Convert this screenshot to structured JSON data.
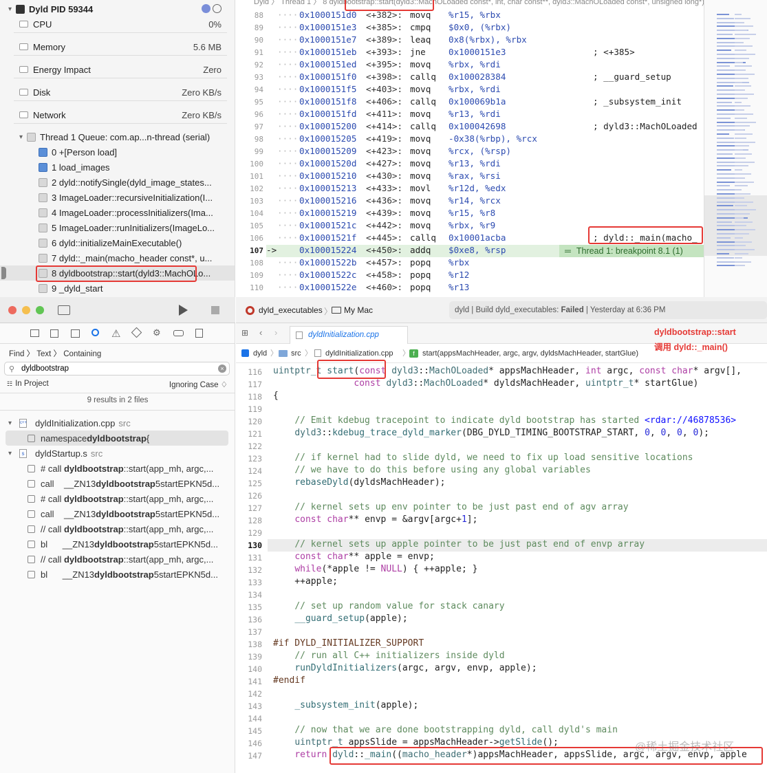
{
  "debug_nav": {
    "process": "Dyld PID 59344",
    "gauges": [
      {
        "label": "CPU",
        "value": "0%"
      },
      {
        "label": "Memory",
        "value": "5.6 MB"
      },
      {
        "label": "Energy Impact",
        "value": "Zero"
      },
      {
        "label": "Disk",
        "value": "Zero KB/s"
      },
      {
        "label": "Network",
        "value": "Zero KB/s"
      }
    ],
    "thread": "Thread 1 Queue: com.ap...n-thread (serial)",
    "frames": [
      "0 +[Person load]",
      "1 load_images",
      "2 dyld::notifySingle(dyld_image_states...",
      "3 ImageLoader::recursiveInitialization(I...",
      "4 ImageLoader::processInitializers(Ima...",
      "5 ImageLoader::runInitializers(ImageLo...",
      "6 dyld::initializeMainExecutable()",
      "7 dyld::_main(macho_header const*, u...",
      "8 dyldbootstrap::start(dyld3::MachOLo...",
      "9 _dyld_start"
    ]
  },
  "disasm": {
    "jumpbar": {
      "p1": "Dyld",
      "p2": "Thread 1",
      "p3": "8 dyldbootstrap::start(dyld3::MachOLoaded const*, int, char const**, dyld3::MachOLoaded const*, unsigned long*)"
    },
    "lines": [
      {
        "n": "88",
        "a": "0x1000151d0",
        "o": "<+382>:",
        "i": "movq",
        "ops": "%r15, %rbx",
        "c": ""
      },
      {
        "n": "89",
        "a": "0x1000151e3",
        "o": "<+385>:",
        "i": "cmpq",
        "ops": "$0x0, (%rbx)",
        "c": ""
      },
      {
        "n": "90",
        "a": "0x1000151e7",
        "o": "<+389>:",
        "i": "leaq",
        "ops": "0x8(%rbx), %rbx",
        "c": ""
      },
      {
        "n": "91",
        "a": "0x1000151eb",
        "o": "<+393>:",
        "i": "jne",
        "ops": "0x1000151e3",
        "c": "; <+385>"
      },
      {
        "n": "92",
        "a": "0x1000151ed",
        "o": "<+395>:",
        "i": "movq",
        "ops": "%rbx, %rdi",
        "c": ""
      },
      {
        "n": "93",
        "a": "0x1000151f0",
        "o": "<+398>:",
        "i": "callq",
        "ops": "0x100028384",
        "c": "; __guard_setup"
      },
      {
        "n": "94",
        "a": "0x1000151f5",
        "o": "<+403>:",
        "i": "movq",
        "ops": "%rbx, %rdi",
        "c": ""
      },
      {
        "n": "95",
        "a": "0x1000151f8",
        "o": "<+406>:",
        "i": "callq",
        "ops": "0x100069b1a",
        "c": "; _subsystem_init"
      },
      {
        "n": "96",
        "a": "0x1000151fd",
        "o": "<+411>:",
        "i": "movq",
        "ops": "%r13, %rdi",
        "c": ""
      },
      {
        "n": "97",
        "a": "0x100015200",
        "o": "<+414>:",
        "i": "callq",
        "ops": "0x100042698",
        "c": "; dyld3::MachOLoaded"
      },
      {
        "n": "98",
        "a": "0x100015205",
        "o": "<+419>:",
        "i": "movq",
        "ops": "-0x38(%rbp), %rcx",
        "c": ""
      },
      {
        "n": "99",
        "a": "0x100015209",
        "o": "<+423>:",
        "i": "movq",
        "ops": "%rcx, (%rsp)",
        "c": ""
      },
      {
        "n": "100",
        "a": "0x10001520d",
        "o": "<+427>:",
        "i": "movq",
        "ops": "%r13, %rdi",
        "c": ""
      },
      {
        "n": "101",
        "a": "0x100015210",
        "o": "<+430>:",
        "i": "movq",
        "ops": "%rax, %rsi",
        "c": ""
      },
      {
        "n": "102",
        "a": "0x100015213",
        "o": "<+433>:",
        "i": "movl",
        "ops": "%r12d, %edx",
        "c": ""
      },
      {
        "n": "103",
        "a": "0x100015216",
        "o": "<+436>:",
        "i": "movq",
        "ops": "%r14, %rcx",
        "c": ""
      },
      {
        "n": "104",
        "a": "0x100015219",
        "o": "<+439>:",
        "i": "movq",
        "ops": "%r15, %r8",
        "c": ""
      },
      {
        "n": "105",
        "a": "0x10001521c",
        "o": "<+442>:",
        "i": "movq",
        "ops": "%rbx, %r9",
        "c": ""
      },
      {
        "n": "106",
        "a": "0x10001521f",
        "o": "<+445>:",
        "i": "callq",
        "ops": "0x10001acba",
        "c": "; dyld::_main(macho_"
      },
      {
        "n": "107",
        "a": "0x100015224",
        "o": "<+450>:",
        "i": "addq",
        "ops": "$0xe8, %rsp",
        "c": ""
      },
      {
        "n": "108",
        "a": "0x10001522b",
        "o": "<+457>:",
        "i": "popq",
        "ops": "%rbx",
        "c": ""
      },
      {
        "n": "109",
        "a": "0x10001522c",
        "o": "<+458>:",
        "i": "popq",
        "ops": "%r12",
        "c": ""
      },
      {
        "n": "110",
        "a": "0x10001522e",
        "o": "<+460>:",
        "i": "popq",
        "ops": "%r13",
        "c": ""
      }
    ],
    "pc_marker": "->",
    "breakpoint": "Thread 1: breakpoint 8.1 (1)"
  },
  "toolbar": {
    "scheme": "dyld_executables",
    "dest": "My Mac",
    "status_prefix": "dyld | Build dyld_executables: ",
    "status_bold": "Failed",
    "status_suffix": " | Yesterday at 6:36 PM"
  },
  "find": {
    "crumb1": "Find",
    "crumb2": "Text",
    "crumb3": "Containing",
    "query": "dyldbootstrap",
    "scope": "In Project",
    "case": "Ignoring Case ♢",
    "summary": "9 results in 2 files",
    "file1": "dyldInitialization.cpp",
    "file1_dir": "src",
    "file2": "dyldStartup.s",
    "file2_dir": "src",
    "r_ns_pre": "namespace ",
    "r_ns_bold": "dyldbootstrap",
    "r_ns_post": " {",
    "results": [
      {
        "pre": "# call ",
        "bold": "dyldbootstrap",
        "post": "::start(app_mh, argc,..."
      },
      {
        "pre": "call    __ZN13",
        "bold": "dyldbootstrap",
        "post": "5startEPKN5d..."
      },
      {
        "pre": "# call ",
        "bold": "dyldbootstrap",
        "post": "::start(app_mh, argc,..."
      },
      {
        "pre": "call    __ZN13",
        "bold": "dyldbootstrap",
        "post": "5startEPKN5d..."
      },
      {
        "pre": "// call ",
        "bold": "dyldbootstrap",
        "post": "::start(app_mh, argc,..."
      },
      {
        "pre": "bl      __ZN13",
        "bold": "dyldbootstrap",
        "post": "5startEPKN5d..."
      },
      {
        "pre": "// call ",
        "bold": "dyldbootstrap",
        "post": "::start(app_mh, argc,..."
      },
      {
        "pre": "bl      __ZN13",
        "bold": "dyldbootstrap",
        "post": "5startEPKN5d..."
      }
    ]
  },
  "editor": {
    "tab": "dyldInitialization.cpp",
    "path": [
      "dyld",
      "src",
      "dyldInitialization.cpp",
      "start(appsMachHeader, argc, argv, dyldsMachHeader, startGlue)"
    ],
    "annotation1": "dyldbootstrap::start",
    "annotation2": "调用 dyld::_main()",
    "watermark": "@稀土掘金技术社区",
    "current_line": "130"
  }
}
